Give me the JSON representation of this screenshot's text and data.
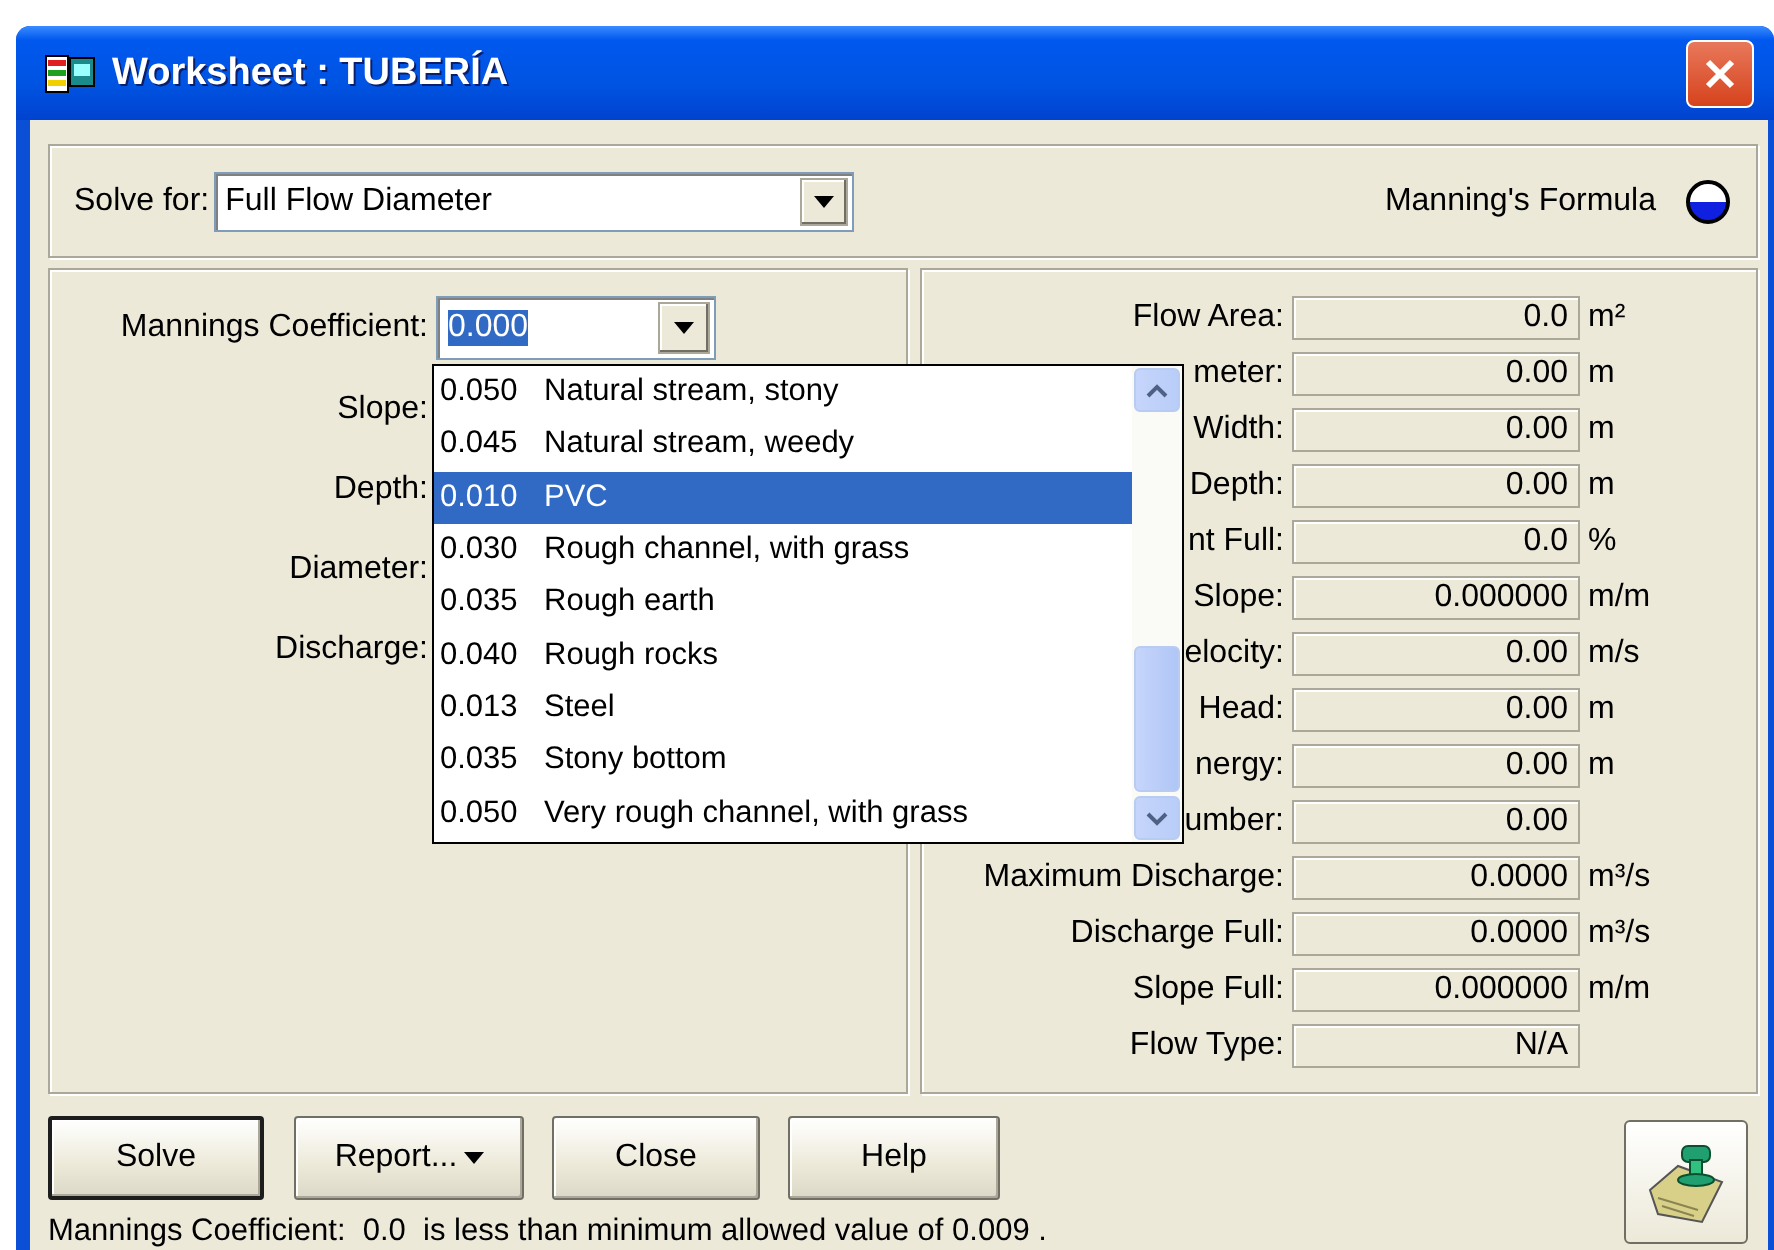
{
  "window": {
    "title": "Worksheet : TUBERÍA"
  },
  "solve_for": {
    "label": "Solve for:",
    "value": "Full Flow Diameter"
  },
  "formula": {
    "label": "Manning's Formula"
  },
  "coefficient": {
    "label": "Mannings Coefficient:",
    "value": "0.000",
    "text_selected": true
  },
  "inputs": [
    {
      "label": "Slope:"
    },
    {
      "label": "Depth:"
    },
    {
      "label": "Diameter:"
    },
    {
      "label": "Discharge:"
    }
  ],
  "dropdown": {
    "items": [
      {
        "value": "0.050",
        "description": "Natural stream, stony",
        "selected": false
      },
      {
        "value": "0.045",
        "description": "Natural stream, weedy",
        "selected": false
      },
      {
        "value": "0.010",
        "description": "PVC",
        "selected": true
      },
      {
        "value": "0.030",
        "description": "Rough channel, with grass",
        "selected": false
      },
      {
        "value": "0.035",
        "description": "Rough earth",
        "selected": false
      },
      {
        "value": "0.040",
        "description": "Rough rocks",
        "selected": false
      },
      {
        "value": "0.013",
        "description": "Steel",
        "selected": false
      },
      {
        "value": "0.035",
        "description": "Stony bottom",
        "selected": false
      },
      {
        "value": "0.050",
        "description": "Very rough channel, with grass",
        "selected": false
      }
    ]
  },
  "results": [
    {
      "label": "Flow Area:",
      "value": "0.0",
      "unit": "m²"
    },
    {
      "label": "meter:",
      "value": "0.00",
      "unit": "m"
    },
    {
      "label": "Width:",
      "value": "0.00",
      "unit": "m"
    },
    {
      "label": "Depth:",
      "value": "0.00",
      "unit": "m"
    },
    {
      "label": "nt Full:",
      "value": "0.0",
      "unit": "%"
    },
    {
      "label": "Slope:",
      "value": "0.000000",
      "unit": "m/m"
    },
    {
      "label": "elocity:",
      "value": "0.00",
      "unit": "m/s"
    },
    {
      "label": "Head:",
      "value": "0.00",
      "unit": "m"
    },
    {
      "label": "nergy:",
      "value": "0.00",
      "unit": "m"
    },
    {
      "label": "umber:",
      "value": "0.00"
    },
    {
      "label": "Maximum Discharge:",
      "value": "0.0000",
      "unit": "m³/s"
    },
    {
      "label": "Discharge Full:",
      "value": "0.0000",
      "unit": "m³/s"
    },
    {
      "label": "Slope Full:",
      "value": "0.000000",
      "unit": "m/m"
    },
    {
      "label": "Flow Type:",
      "value": "N/A"
    }
  ],
  "buttons": [
    {
      "label": "Solve",
      "kind": "default"
    },
    {
      "label": "Report...",
      "kind": "menu"
    },
    {
      "label": "Close",
      "kind": "plain"
    },
    {
      "label": "Help",
      "kind": "plain"
    }
  ],
  "status_bar": "Mannings Coefficient:  0.0  is less than minimum allowed value of 0.009 ."
}
